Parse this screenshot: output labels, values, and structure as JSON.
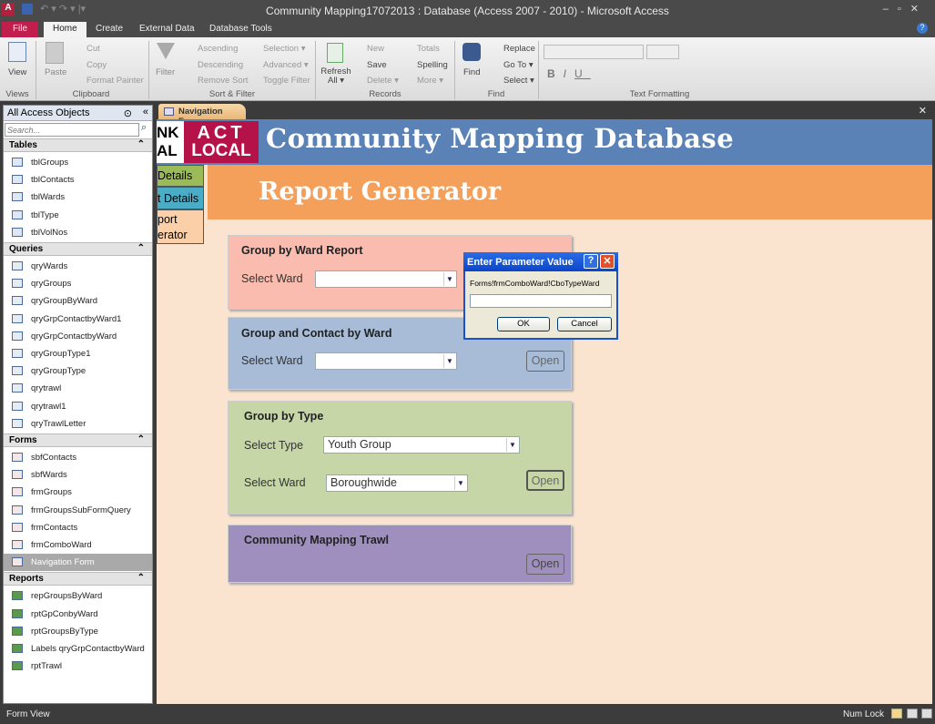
{
  "window": {
    "title": "Community Mapping17072013 : Database (Access 2007 - 2010)  -  Microsoft Access"
  },
  "ribbon_tabs": [
    "File",
    "Home",
    "Create",
    "External Data",
    "Database Tools"
  ],
  "ribbon": {
    "views": {
      "view": "View",
      "group": "Views"
    },
    "clipboard": {
      "paste": "Paste",
      "cut": "Cut",
      "copy": "Copy",
      "format_painter": "Format Painter",
      "group": "Clipboard"
    },
    "sort": {
      "filter": "Filter",
      "ascending": "Ascending",
      "descending": "Descending",
      "remove_sort": "Remove Sort",
      "selection": "Selection ▾",
      "advanced": "Advanced ▾",
      "toggle_filter": "Toggle Filter",
      "group": "Sort & Filter"
    },
    "records": {
      "refresh": "Refresh All ▾",
      "new": "New",
      "save": "Save",
      "delete": "Delete ▾",
      "totals": "Totals",
      "spelling": "Spelling",
      "more": "More ▾",
      "group": "Records"
    },
    "find": {
      "find": "Find",
      "replace": "Replace",
      "goto": "Go To ▾",
      "select": "Select ▾",
      "group": "Find"
    },
    "text": {
      "group": "Text Formatting"
    }
  },
  "nav": {
    "header": "All Access Objects",
    "search_placeholder": "Search...",
    "sections": [
      {
        "title": "Tables",
        "items": [
          "tblGroups",
          "tblContacts",
          "tblWards",
          "tblType",
          "tblVolNos"
        ]
      },
      {
        "title": "Queries",
        "items": [
          "qryWards",
          "qryGroups",
          "qryGroupByWard",
          "qryGrpContactbyWard1",
          "qryGrpContactbyWard",
          "qryGroupType1",
          "qryGroupType",
          "qrytrawl",
          "qrytrawl1",
          "qryTrawlLetter"
        ]
      },
      {
        "title": "Forms",
        "items": [
          "sbfContacts",
          "sbfWards",
          "frmGroups",
          "frmGroupsSubFormQuery",
          "frmContacts",
          "frmComboWard",
          "Navigation Form"
        ]
      },
      {
        "title": "Reports",
        "items": [
          "repGroupsByWard",
          "rptGpConbyWard",
          "rptGroupsByType",
          "Labels qryGrpContactbyWard",
          "rptTrawl"
        ]
      }
    ]
  },
  "doc_tab": "Navigation Form",
  "form": {
    "logo": {
      "left_top": "NK",
      "left_bottom": "AL",
      "act": "ACT",
      "local": "LOCAL"
    },
    "title": "Community Mapping Database",
    "subtitle": "Report Generator",
    "side_tabs": [
      "Details",
      "t Details",
      "port\nerator"
    ],
    "panels": {
      "ward": {
        "title": "Group by Ward Report",
        "label": "Select Ward",
        "value": ""
      },
      "contact": {
        "title": "Group and Contact by Ward",
        "label": "Select Ward",
        "value": "",
        "open": "Open"
      },
      "type": {
        "title": "Group by Type",
        "type_label": "Select Type",
        "type_value": "Youth Group",
        "ward_label": "Select Ward",
        "ward_value": "Boroughwide",
        "open": "Open"
      },
      "trawl": {
        "title": "Community Mapping Trawl",
        "open": "Open"
      }
    }
  },
  "dialog": {
    "title": "Enter Parameter Value",
    "prompt": "Forms!frmComboWard!CboTypeWard",
    "value": "",
    "ok": "OK",
    "cancel": "Cancel"
  },
  "status": {
    "left": "Form View",
    "num_lock": "Num Lock"
  }
}
